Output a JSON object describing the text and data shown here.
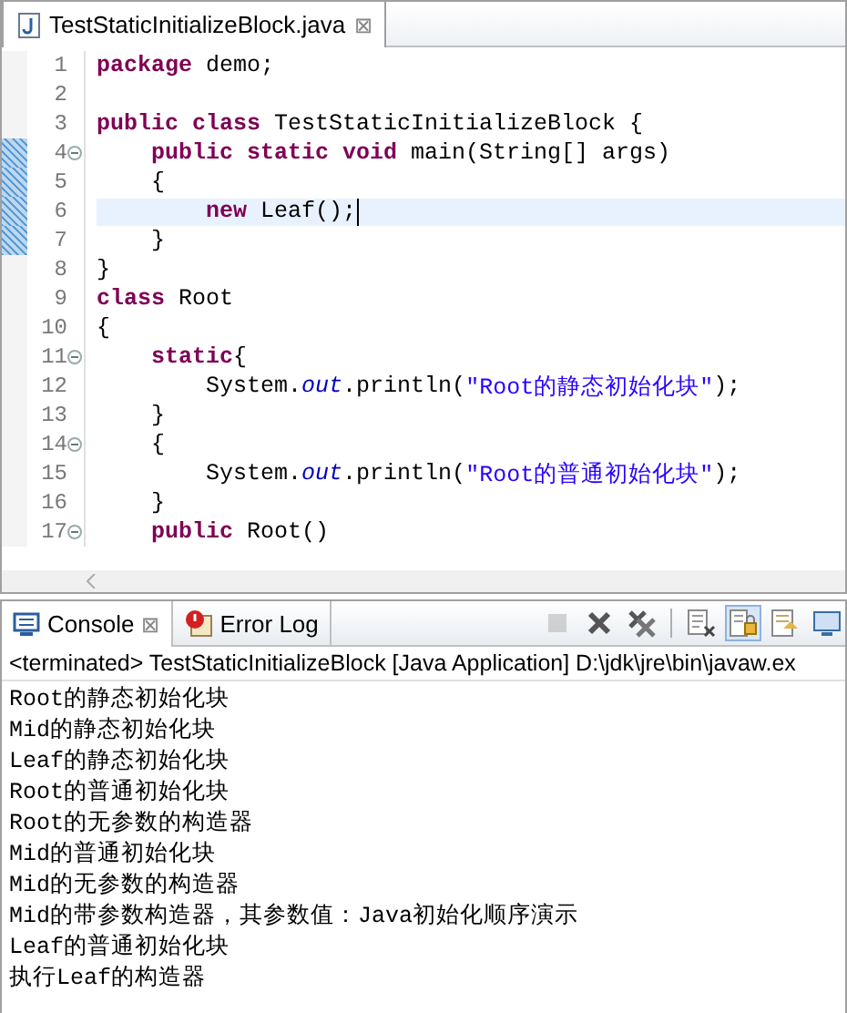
{
  "editor": {
    "tab": {
      "title": "TestStaticInitializeBlock.java",
      "close": "⊠"
    },
    "lines": [
      {
        "number": "1",
        "fold": false,
        "changed": false,
        "current": false,
        "tokens": [
          {
            "kind": "keyword",
            "text": "package"
          },
          {
            "kind": "plain",
            "text": " demo;"
          }
        ]
      },
      {
        "number": "2",
        "fold": false,
        "changed": false,
        "current": false
      },
      {
        "number": "3",
        "fold": false,
        "changed": false,
        "current": false,
        "tokens": [
          {
            "kind": "keyword",
            "text": "public class"
          },
          {
            "kind": "plain",
            "text": " TestStaticInitializeBlock {"
          }
        ]
      },
      {
        "number": "4",
        "fold": true,
        "changed": true,
        "current": false,
        "tokens": [
          {
            "kind": "keyword",
            "text": "    public static void"
          },
          {
            "kind": "plain",
            "text": " main(String[] args)"
          }
        ]
      },
      {
        "number": "5",
        "fold": false,
        "changed": true,
        "current": false,
        "tokens": [
          {
            "kind": "plain",
            "text": "    {"
          }
        ]
      },
      {
        "number": "6",
        "fold": false,
        "changed": true,
        "current": true,
        "tokens": [
          {
            "kind": "keyword",
            "text": "        new"
          },
          {
            "kind": "plain",
            "text": " Leaf();"
          }
        ]
      },
      {
        "number": "7",
        "fold": false,
        "changed": true,
        "current": false,
        "tokens": [
          {
            "kind": "plain",
            "text": "    }"
          }
        ]
      },
      {
        "number": "8",
        "fold": false,
        "changed": false,
        "current": false,
        "tokens": [
          {
            "kind": "plain",
            "text": "}"
          }
        ]
      },
      {
        "number": "9",
        "fold": false,
        "changed": false,
        "current": false,
        "tokens": [
          {
            "kind": "keyword",
            "text": "class"
          },
          {
            "kind": "plain",
            "text": " Root"
          }
        ]
      },
      {
        "number": "10",
        "fold": false,
        "changed": false,
        "current": false,
        "tokens": [
          {
            "kind": "plain",
            "text": "{"
          }
        ]
      },
      {
        "number": "11",
        "fold": true,
        "changed": false,
        "current": false,
        "tokens": [
          {
            "kind": "keyword",
            "text": "    static"
          },
          {
            "kind": "plain",
            "text": "{"
          }
        ]
      },
      {
        "number": "12",
        "fold": false,
        "changed": false,
        "current": false,
        "tokens": [
          {
            "kind": "plain",
            "text": "        System."
          },
          {
            "kind": "field",
            "text": "out"
          },
          {
            "kind": "plain",
            "text": ".println("
          },
          {
            "kind": "string",
            "text": "\"Root的静态初始化块\""
          },
          {
            "kind": "plain",
            "text": ");"
          }
        ]
      },
      {
        "number": "13",
        "fold": false,
        "changed": false,
        "current": false,
        "tokens": [
          {
            "kind": "plain",
            "text": "    }"
          }
        ]
      },
      {
        "number": "14",
        "fold": true,
        "changed": false,
        "current": false,
        "tokens": [
          {
            "kind": "plain",
            "text": "    {"
          }
        ]
      },
      {
        "number": "15",
        "fold": false,
        "changed": false,
        "current": false,
        "tokens": [
          {
            "kind": "plain",
            "text": "        System."
          },
          {
            "kind": "field",
            "text": "out"
          },
          {
            "kind": "plain",
            "text": ".println("
          },
          {
            "kind": "string",
            "text": "\"Root的普通初始化块\""
          },
          {
            "kind": "plain",
            "text": ");"
          }
        ]
      },
      {
        "number": "16",
        "fold": false,
        "changed": false,
        "current": false,
        "tokens": [
          {
            "kind": "plain",
            "text": "    }"
          }
        ]
      },
      {
        "number": "17",
        "fold": true,
        "changed": false,
        "current": false,
        "tokens": [
          {
            "kind": "keyword",
            "text": "    public"
          },
          {
            "kind": "plain",
            "text": " Root()"
          }
        ]
      }
    ]
  },
  "console": {
    "tabs": [
      {
        "label": "Console",
        "kind": "console",
        "selected": true,
        "close": "⊠"
      },
      {
        "label": "Error Log",
        "kind": "errorlog",
        "selected": false
      }
    ],
    "toolbar": [
      {
        "kind": "stop",
        "disabled": true
      },
      {
        "kind": "remove"
      },
      {
        "kind": "removeall"
      },
      {
        "kind": "separator"
      },
      {
        "kind": "clear"
      },
      {
        "kind": "lock",
        "selected": true
      },
      {
        "kind": "pin"
      },
      {
        "kind": "display"
      }
    ],
    "status": "<terminated> TestStaticInitializeBlock [Java Application] D:\\jdk\\jre\\bin\\javaw.ex",
    "output": [
      "Root的静态初始化块",
      "Mid的静态初始化块",
      "Leaf的静态初始化块",
      "Root的普通初始化块",
      "Root的无参数的构造器",
      "Mid的普通初始化块",
      "Mid的无参数的构造器",
      "Mid的带参数构造器，其参数值：Java初始化顺序演示",
      "Leaf的普通初始化块",
      "执行Leaf的构造器"
    ]
  }
}
